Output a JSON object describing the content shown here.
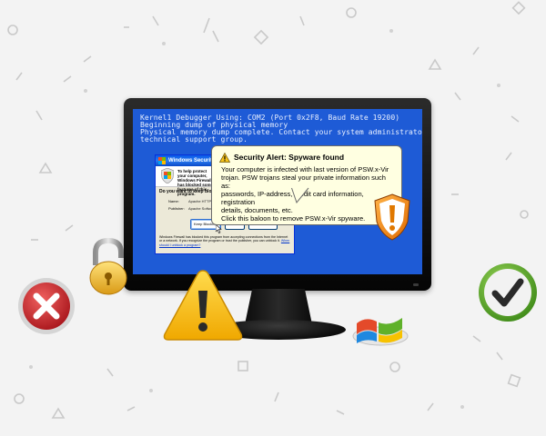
{
  "screen": {
    "bsod_lines": [
      "Kernel1 Debugger Using: COM2 (Port 0x2F8, Baud Rate 19200)",
      "Beginning dump of physical memory",
      "Physical memory dump complete. Contact your system administrator or",
      "technical support group."
    ]
  },
  "security_dialog": {
    "title": "Windows Security Alert",
    "header_text": "To help protect your computer, Windows Firewall has blocked some features of this program.",
    "question": "Do you want to keep blocking",
    "name_label": "Name:",
    "name_value": "Apache HTTP Server",
    "publisher_label": "Publisher:",
    "publisher_value": "Apache Software Foundation",
    "buttons": [
      "Keep Blocking",
      "Unblock",
      "Ask Me Later"
    ],
    "footer_text": "Windows Firewall has blocked this program from accepting connections from the Internet or a network. If you recognize the program or trust the publisher, you can unblock it.",
    "footer_link": "When should I unblock a program?"
  },
  "balloon": {
    "title": "Security Alert: Spyware found",
    "lines": [
      "Your computer is infected with last version of PSW.x-Vir",
      "trojan. PSW trojans steal your private information such as:",
      "passwords, IP-address, credit card information, registration",
      "details, documents, etc.",
      "Click this baloon to remove PSW.x-Vir spyware."
    ]
  },
  "colors": {
    "screen_blue": "#1e5bd6",
    "balloon_bg": "#ffffe1",
    "warning_yellow": "#f7c31b",
    "error_red": "#c8262c",
    "ok_green": "#59a82a",
    "background": "#f3f3f3"
  },
  "icons": [
    "warning-icon",
    "orange-shield-icon",
    "padlock-icon",
    "red-x-icon",
    "green-check-icon",
    "windows-flag-icon",
    "mouse-cursor-icon"
  ]
}
